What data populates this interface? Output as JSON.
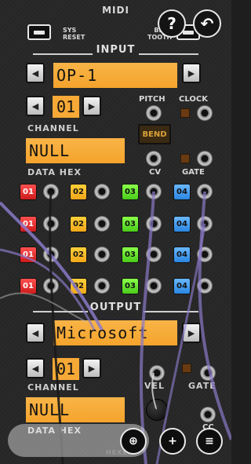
{
  "header": {
    "title": "MIDI",
    "sys_reset": "SYS\nRESET",
    "bluetooth": "BLUE\nTOOTH",
    "help_glyph": "?",
    "back_glyph": "↶"
  },
  "input": {
    "section_label": "INPUT",
    "device": "OP-1",
    "channel_value": "01",
    "channel_label": "CHANNEL",
    "data_hex_value": "NULL",
    "data_hex_label": "DATA HEX",
    "pitch_label": "PITCH",
    "clock_label": "CLOCK",
    "bend_label": "BEND",
    "cv_label": "CV",
    "gate_label": "GATE"
  },
  "channels": {
    "rows": [
      [
        "01",
        "02",
        "03",
        "04"
      ],
      [
        "01",
        "02",
        "03",
        "04"
      ],
      [
        "01",
        "02",
        "03",
        "04"
      ],
      [
        "01",
        "02",
        "03",
        "04"
      ]
    ]
  },
  "output": {
    "section_label": "OUTPUT",
    "device": "Microsoft",
    "channel_value": "01",
    "channel_label": "CHANNEL",
    "data_hex_value": "NULL",
    "data_hex_label": "DATA HEX",
    "vel_label": "VEL",
    "gate_label": "GATE",
    "cc_label": "CC",
    "hexen_label": "HEXEN"
  },
  "arrows": {
    "left": "◀",
    "right": "▶"
  },
  "bottom": {
    "search_glyph": "⊕",
    "add_glyph": "+",
    "menu_glyph": "≡"
  },
  "colors": {
    "display": "#f6a936",
    "red": "#e62a2a",
    "yellow": "#f5b521",
    "green": "#5ee02a",
    "blue": "#3a97f0",
    "cable": "#8a79c8"
  }
}
